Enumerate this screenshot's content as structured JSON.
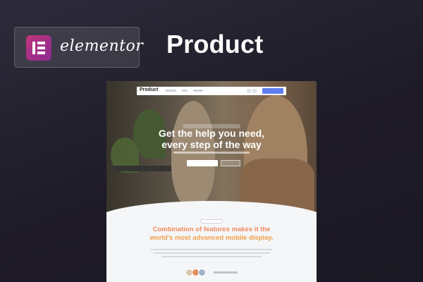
{
  "brand": {
    "name": "elementor",
    "logo_icon": "elementor-e-icon",
    "logo_color": "#b9317c"
  },
  "page": {
    "title": "Product"
  },
  "preview": {
    "nav_brand": "Product",
    "hero_headline_line1": "Get the help you need,",
    "hero_headline_line2": "every step of the way",
    "feature_headline_line1": "Combination of features makes it the",
    "feature_headline_line2": "world's most advanced mobile display.",
    "accent_colors": [
      "#f08a5d",
      "#f0a04b",
      "#5f7ef0"
    ]
  }
}
